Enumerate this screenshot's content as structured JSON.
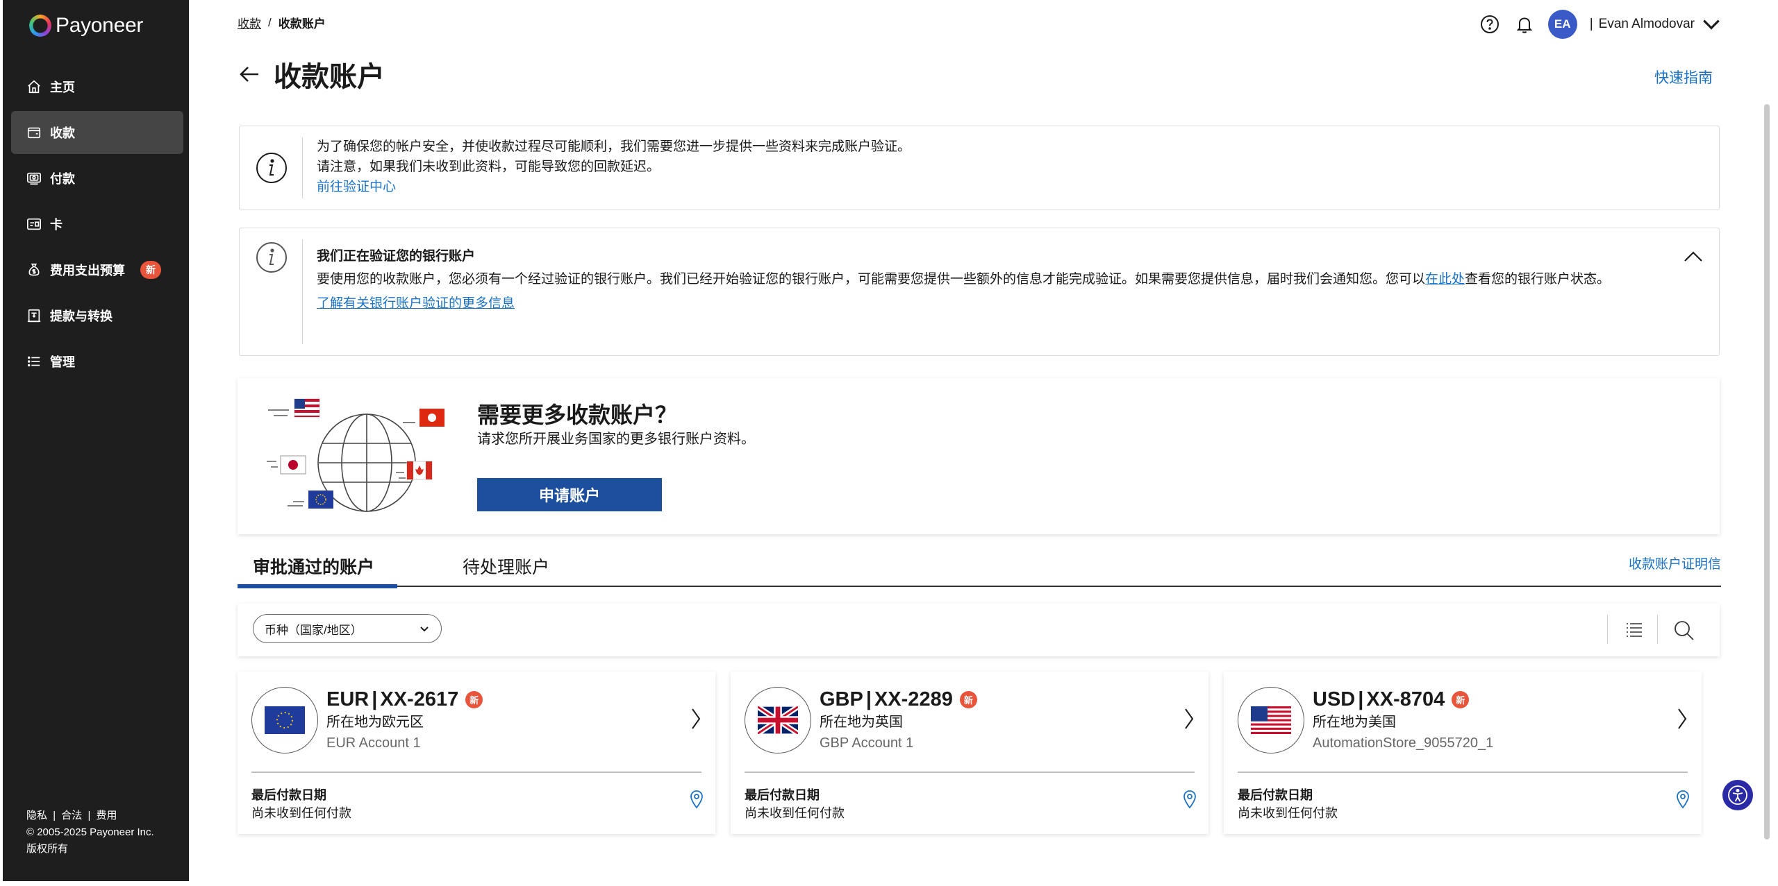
{
  "brand": {
    "name": "Payoneer"
  },
  "sidebar": {
    "items": [
      {
        "label": "主页",
        "icon": "home-icon"
      },
      {
        "label": "收款",
        "icon": "wallet-icon",
        "active": true
      },
      {
        "label": "付款",
        "icon": "payment-icon"
      },
      {
        "label": "卡",
        "icon": "card-icon"
      },
      {
        "label": "费用支出预算",
        "icon": "money-bag-icon",
        "badge": "新"
      },
      {
        "label": "提款与转换",
        "icon": "withdraw-icon"
      },
      {
        "label": "管理",
        "icon": "list-icon"
      }
    ],
    "footer": {
      "privacy": "隐私",
      "legal": "合法",
      "fees": "费用",
      "sep": "|",
      "copyright": "© 2005-2025 Payoneer Inc.",
      "rights": "版权所有"
    }
  },
  "breadcrumb": {
    "parent": "收款",
    "sep": "/",
    "current": "收款账户"
  },
  "header": {
    "avatar_initials": "EA",
    "sep": "|",
    "user_name": "Evan Almodovar"
  },
  "page": {
    "title": "收款账户",
    "quick_guide": "快速指南"
  },
  "notice1": {
    "line1": "为了确保您的帐户安全，并使收款过程尽可能顺利，我们需要您进一步提供一些资料来完成账户验证。",
    "line2": "请注意，如果我们未收到此资料，可能导致您的回款延迟。",
    "link": "前往验证中心"
  },
  "notice2": {
    "title": "我们正在验证您的银行账户",
    "body_before": "要使用您的收款账户，您必须有一个经过验证的银行账户。我们已经开始验证您的银行账户，可能需要您提供一些额外的信息才能完成验证。如果需要您提供信息，届时我们会通知您。您可以",
    "body_link": "在此处",
    "body_after": "查看您的银行账户状态。",
    "more_link": "了解有关银行账户验证的更多信息"
  },
  "promo": {
    "title": "需要更多收款账户？",
    "subtitle": "请求您所开展业务国家的更多银行账户资料。",
    "button": "申请账户"
  },
  "tabs": {
    "approved": "审批通过的账户",
    "pending": "待处理账户",
    "certificate": "收款账户证明信"
  },
  "filter": {
    "currency_label": "币种（国家/地区）"
  },
  "accounts": [
    {
      "currency": "EUR",
      "sep": "|",
      "number": "XX-2617",
      "badge": "新",
      "location": "所在地为欧元区",
      "name": "EUR Account 1",
      "last_payment_label": "最后付款日期",
      "last_payment_value": "尚未收到任何付款",
      "flag": "eu-flag"
    },
    {
      "currency": "GBP",
      "sep": "|",
      "number": "XX-2289",
      "badge": "新",
      "location": "所在地为英国",
      "name": "GBP Account 1",
      "last_payment_label": "最后付款日期",
      "last_payment_value": "尚未收到任何付款",
      "flag": "uk-flag"
    },
    {
      "currency": "USD",
      "sep": "|",
      "number": "XX-8704",
      "badge": "新",
      "location": "所在地为美国",
      "name": "AutomationStore_9055720_1",
      "last_payment_label": "最后付款日期",
      "last_payment_value": "尚未收到任何付款",
      "flag": "us-flag"
    }
  ],
  "colors": {
    "sidebar_bg": "#1e1e1e",
    "primary_button": "#1d4f9f",
    "link": "#1b72c4",
    "badge": "#e9553b",
    "avatar": "#3a5bc7"
  }
}
